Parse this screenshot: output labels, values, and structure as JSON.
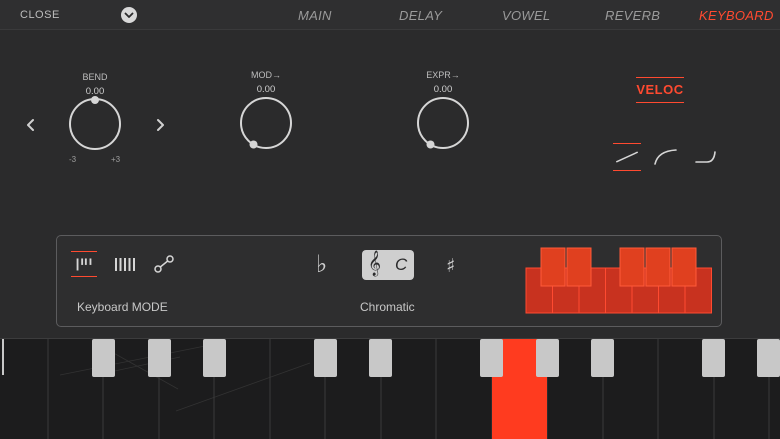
{
  "topbar": {
    "close_label": "CLOSE",
    "menu_icon": "chevron-down-icon",
    "tabs": [
      {
        "label": "MAIN",
        "active": false
      },
      {
        "label": "DELAY",
        "active": false
      },
      {
        "label": "VOWEL",
        "active": false
      },
      {
        "label": "REVERB",
        "active": false
      },
      {
        "label": "KEYBOARD",
        "active": true
      }
    ]
  },
  "controls": {
    "bend": {
      "label": "BEND",
      "value": "0.00",
      "min_label": "-3",
      "max_label": "+3",
      "prev_icon": "chevron-left-icon",
      "next_icon": "chevron-right-icon"
    },
    "mod": {
      "label": "MOD→",
      "value": "0.00"
    },
    "expr": {
      "label": "EXPR→",
      "value": "0.00"
    },
    "veloc": {
      "label": "VELOC",
      "active": true
    },
    "velocity_curves": [
      {
        "name": "linear-curve-icon",
        "active": true
      },
      {
        "name": "log-curve-icon",
        "active": false
      },
      {
        "name": "exp-curve-icon",
        "active": false
      }
    ]
  },
  "panel": {
    "mode_label": "Keyboard MODE",
    "modes": [
      {
        "name": "split-keys-icon",
        "active": true
      },
      {
        "name": "full-keys-icon",
        "active": false
      },
      {
        "name": "link-icon",
        "active": false
      }
    ],
    "flat_symbol": "♭",
    "clef_symbol": "𝄞",
    "key": "C",
    "sharp_symbol": "♯",
    "scale_label": "Chromatic"
  },
  "colors": {
    "accent": "#ff4a30",
    "background": "#2b2b2c",
    "panel_border": "#5c5c5e",
    "white_key": "#1c1c1d",
    "black_key": "#c8c8c8",
    "pressed_key": "#ff3b1f"
  }
}
